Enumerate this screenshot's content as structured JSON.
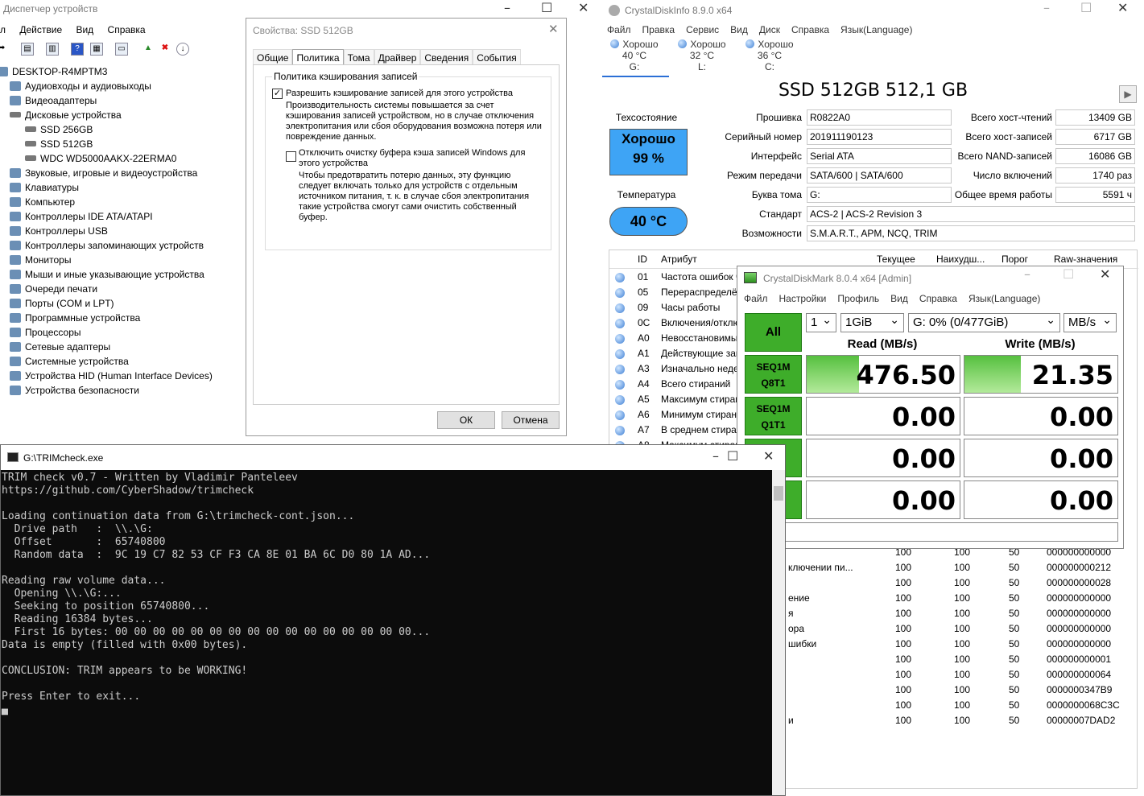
{
  "device_manager": {
    "title": "Диспетчер устройств",
    "menu": [
      "л",
      "Действие",
      "Вид",
      "Справка"
    ],
    "computer": "DESKTOP-R4MPTM3",
    "items": [
      "Аудиовходы и аудиовыходы",
      "Видеоадаптеры",
      "Дисковые устройства"
    ],
    "disks": [
      "SSD 256GB",
      "SSD 512GB",
      "WDC WD5000AAKX-22ERMA0"
    ],
    "more_items": [
      "Звуковые, игровые и видеоустройства",
      "Клавиатуры",
      "Компьютер",
      "Контроллеры IDE ATA/ATAPI",
      "Контроллеры USB",
      "Контроллеры запоминающих устройств",
      "Мониторы",
      "Мыши и иные указывающие устройства",
      "Очереди печати",
      "Порты (COM и LPT)",
      "Программные устройства",
      "Процессоры",
      "Сетевые адаптеры",
      "Системные устройства",
      "Устройства HID (Human Interface Devices)",
      "Устройства безопасности"
    ]
  },
  "properties": {
    "title": "Свойства: SSD 512GB",
    "tabs": [
      "Общие",
      "Политика",
      "Тома",
      "Драйвер",
      "Сведения",
      "События"
    ],
    "group_label": "Политика кэширования записей",
    "cb1_label": "Разрешить кэширование записей для этого устройства",
    "cb1_desc": "Производительность системы повышается за счет кэширования записей устройством, но в случае отключения электропитания или сбоя оборудования возможна потеря или повреждение данных.",
    "cb2_label": "Отключить очистку буфера кэша записей Windows для этого устройства",
    "cb2_desc": "Чтобы предотвратить потерю данных, эту функцию следует включать только для устройств с отдельным источником питания, т. к. в случае сбоя электропитания такие устройства смогут сами очистить собственный буфер.",
    "ok": "ОК",
    "cancel": "Отмена"
  },
  "cdi": {
    "title": "CrystalDiskInfo 8.9.0 x64",
    "menu": [
      "Файл",
      "Правка",
      "Сервис",
      "Вид",
      "Диск",
      "Справка",
      "Язык(Language)"
    ],
    "drives": [
      {
        "status": "Хорошо",
        "temp": "40 °C",
        "letter": "G:"
      },
      {
        "status": "Хорошо",
        "temp": "32 °C",
        "letter": "L:"
      },
      {
        "status": "Хорошо",
        "temp": "36 °C",
        "letter": "C:"
      }
    ],
    "disk_title": "SSD 512GB 512,1 GB",
    "health_label": "Техсостояние",
    "health_status": "Хорошо",
    "health_pct": "99 %",
    "temp_label": "Температура",
    "temp_value": "40 °C",
    "left_fields": [
      {
        "label": "Прошивка",
        "value": "R0822A0"
      },
      {
        "label": "Серийный номер",
        "value": "201911190123"
      },
      {
        "label": "Интерфейс",
        "value": "Serial ATA"
      },
      {
        "label": "Режим передачи",
        "value": "SATA/600 | SATA/600"
      },
      {
        "label": "Буква тома",
        "value": "G:"
      }
    ],
    "right_fields": [
      {
        "label": "Всего хост-чтений",
        "value": "13409 GB"
      },
      {
        "label": "Всего хост-записей",
        "value": "6717 GB"
      },
      {
        "label": "Всего NAND-записей",
        "value": "16086 GB"
      },
      {
        "label": "Число включений",
        "value": "1740 раз"
      },
      {
        "label": "Общее время работы",
        "value": "5591 ч"
      }
    ],
    "standard_label": "Стандарт",
    "standard_value": "ACS-2 | ACS-2 Revision 3",
    "features_label": "Возможности",
    "features_value": "S.M.A.R.T., APM, NCQ, TRIM",
    "smart_headers": [
      "ID",
      "Атрибут",
      "Текущее",
      "Наихудш...",
      "Порог",
      "Raw-значения"
    ],
    "smart_rows": [
      {
        "id": "01",
        "attr": "Частота ошибок чт"
      },
      {
        "id": "05",
        "attr": "Перераспределённ"
      },
      {
        "id": "09",
        "attr": "Часы работы"
      },
      {
        "id": "0C",
        "attr": "Включения/отклю"
      },
      {
        "id": "A0",
        "attr": "Невосстановимые"
      },
      {
        "id": "A1",
        "attr": "Действующие запа"
      },
      {
        "id": "A3",
        "attr": "Изначально неде"
      },
      {
        "id": "A4",
        "attr": "Всего стираний"
      },
      {
        "id": "A5",
        "attr": "Максимум стиран"
      },
      {
        "id": "A6",
        "attr": "Минимум стирани"
      },
      {
        "id": "A7",
        "attr": "В среднем стиран"
      },
      {
        "id": "A8",
        "attr": "Максимум стиран"
      }
    ],
    "smart_lower": [
      {
        "attr": "",
        "cur": "100",
        "worst": "100",
        "thr": "50",
        "raw": "000000000000"
      },
      {
        "attr": "ключении пи...",
        "cur": "100",
        "worst": "100",
        "thr": "50",
        "raw": "000000000212"
      },
      {
        "attr": "",
        "cur": "100",
        "worst": "100",
        "thr": "50",
        "raw": "000000000028"
      },
      {
        "attr": "ение",
        "cur": "100",
        "worst": "100",
        "thr": "50",
        "raw": "000000000000"
      },
      {
        "attr": "я",
        "cur": "100",
        "worst": "100",
        "thr": "50",
        "raw": "000000000000"
      },
      {
        "attr": "ора",
        "cur": "100",
        "worst": "100",
        "thr": "50",
        "raw": "000000000000"
      },
      {
        "attr": "шибки",
        "cur": "100",
        "worst": "100",
        "thr": "50",
        "raw": "000000000000"
      },
      {
        "attr": "",
        "cur": "100",
        "worst": "100",
        "thr": "50",
        "raw": "000000000001"
      },
      {
        "attr": "",
        "cur": "100",
        "worst": "100",
        "thr": "50",
        "raw": "000000000064"
      },
      {
        "attr": "",
        "cur": "100",
        "worst": "100",
        "thr": "50",
        "raw": "0000000347B9"
      },
      {
        "attr": "",
        "cur": "100",
        "worst": "100",
        "thr": "50",
        "raw": "0000000068C3C"
      },
      {
        "attr": "и",
        "cur": "100",
        "worst": "100",
        "thr": "50",
        "raw": "00000007DAD2"
      }
    ]
  },
  "cdm": {
    "title": "CrystalDiskMark 8.0.4 x64 [Admin]",
    "menu": [
      "Файл",
      "Настройки",
      "Профиль",
      "Вид",
      "Справка",
      "Язык(Language)"
    ],
    "all": "All",
    "count": "1",
    "size": "1GiB",
    "drive": "G: 0% (0/477GiB)",
    "unit": "MB/s",
    "read_header": "Read (MB/s)",
    "write_header": "Write (MB/s)",
    "tests": [
      {
        "l1": "SEQ1M",
        "l2": "Q8T1",
        "read": "476.50",
        "write": "21.35",
        "read_frac": 0.34,
        "write_frac": 0.37
      },
      {
        "l1": "SEQ1M",
        "l2": "Q1T1",
        "read": "0.00",
        "write": "0.00",
        "read_frac": 0,
        "write_frac": 0
      },
      {
        "l1": "",
        "l2": "",
        "read": "0.00",
        "write": "0.00",
        "read_frac": 0,
        "write_frac": 0
      },
      {
        "l1": "",
        "l2": "",
        "read": "0.00",
        "write": "0.00",
        "read_frac": 0,
        "write_frac": 0
      }
    ]
  },
  "trim": {
    "title": "G:\\TRIMcheck.exe",
    "output": "TRIM check v0.7 - Written by Vladimir Panteleev\nhttps://github.com/CyberShadow/trimcheck\n\nLoading continuation data from G:\\trimcheck-cont.json...\n  Drive path   :  \\\\.\\G:\n  Offset       :  65740800\n  Random data  :  9C 19 C7 82 53 CF F3 CA 8E 01 BA 6C D0 80 1A AD...\n\nReading raw volume data...\n  Opening \\\\.\\G:...\n  Seeking to position 65740800...\n  Reading 16384 bytes...\n  First 16 bytes: 00 00 00 00 00 00 00 00 00 00 00 00 00 00 00 00...\nData is empty (filled with 0x00 bytes).\n\nCONCLUSION: TRIM appears to be WORKING!\n\nPress Enter to exit...\n▄"
  }
}
